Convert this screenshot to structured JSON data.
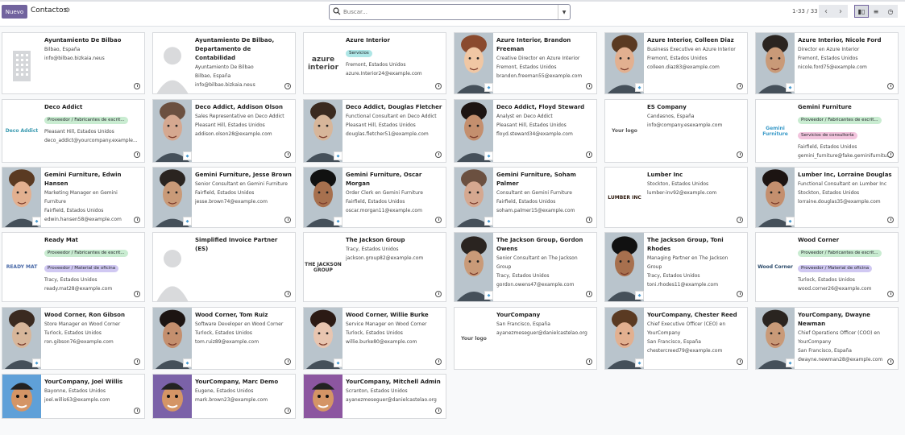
{
  "control_panel": {
    "new_label": "Nuevo",
    "title": "Contactos",
    "search_placeholder": "Buscar...",
    "pager": "1-33 / 33"
  },
  "colors": {
    "primary": "#71639e",
    "tag_green": "#c9ecd1",
    "tag_teal": "#aee6e6",
    "tag_purple": "#d0c8f2",
    "tag_pink": "#f2c4dd"
  },
  "contacts": [
    {
      "name": "Ayuntamiento De Bilbao",
      "lines": [
        "Bilbao, España",
        "info@bilbao.bizkaia.neus"
      ],
      "tags": [],
      "thumb": "building-icon"
    },
    {
      "name": "Ayuntamiento De Bilbao, Departamento de Contabilidad",
      "lines": [
        "Ayuntamiento De Bilbao",
        "Bilbao, España",
        "info@bilbao.bizkaia.neus"
      ],
      "tags": [],
      "thumb": "person-silhouette"
    },
    {
      "name": "Azure Interior",
      "lines": [
        "Fremont, Estados Unidos",
        "azure.Interior24@example.com"
      ],
      "tags": [
        {
          "label": "Servicios",
          "color": "teal"
        }
      ],
      "thumb": "azure-logo",
      "logo_text": "azure interior"
    },
    {
      "name": "Azure Interior, Brandon Freeman",
      "lines": [
        "Creative Director en Azure Interior",
        "Fremont, Estados Unidos",
        "brandon.freeman55@example.com"
      ],
      "tags": [],
      "thumb": "photo"
    },
    {
      "name": "Azure Interior, Colleen Diaz",
      "lines": [
        "Business Executive en Azure Interior",
        "Fremont, Estados Unidos",
        "colleen.diaz83@example.com"
      ],
      "tags": [],
      "thumb": "photo"
    },
    {
      "name": "Azure Interior, Nicole Ford",
      "lines": [
        "Director en Azure Interior",
        "Fremont, Estados Unidos",
        "nicole.ford75@example.com"
      ],
      "tags": [],
      "thumb": "photo"
    },
    {
      "name": "Deco Addict",
      "lines": [
        "Pleasant Hill, Estados Unidos",
        "deco_addict@yourcompany.example..."
      ],
      "tags": [
        {
          "label": "Proveedor / Fabricantes de escrit...",
          "color": "green"
        }
      ],
      "thumb": "deco-logo",
      "logo_text": "Deco Addict"
    },
    {
      "name": "Deco Addict, Addison Olson",
      "lines": [
        "Sales Representative en Deco Addict",
        "Pleasant Hill, Estados Unidos",
        "addison.olson28@example.com"
      ],
      "tags": [],
      "thumb": "photo"
    },
    {
      "name": "Deco Addict, Douglas Fletcher",
      "lines": [
        "Functional Consultant en Deco Addict",
        "Pleasant Hill, Estados Unidos",
        "douglas.fletcher51@example.com"
      ],
      "tags": [],
      "thumb": "photo"
    },
    {
      "name": "Deco Addict, Floyd Steward",
      "lines": [
        "Analyst en Deco Addict",
        "Pleasant Hill, Estados Unidos",
        "floyd.steward34@example.com"
      ],
      "tags": [],
      "thumb": "photo"
    },
    {
      "name": "ES Company",
      "lines": [
        "Candasnos, España",
        "info@company.esexample.com"
      ],
      "tags": [],
      "thumb": "your-logo",
      "logo_text": "Your logo"
    },
    {
      "name": "Gemini Furniture",
      "lines": [
        "Fairfield, Estados Unidos",
        "gemini_furniture@fake.geminifurnitu..."
      ],
      "tags": [
        {
          "label": "Proveedor / Fabricantes de escrit...",
          "color": "green"
        },
        {
          "label": "Servicios de consultoría",
          "color": "pink"
        }
      ],
      "thumb": "gemini-logo",
      "logo_text": "Gemini Furniture"
    },
    {
      "name": "Gemini Furniture, Edwin Hansen",
      "lines": [
        "Marketing Manager en Gemini",
        "Furniture",
        "Fairfield, Estados Unidos",
        "edwin.hansen58@example.com"
      ],
      "tags": [],
      "thumb": "photo"
    },
    {
      "name": "Gemini Furniture, Jesse Brown",
      "lines": [
        "Senior Consultant en Gemini Furniture",
        "Fairfield, Estados Unidos",
        "jesse.brown74@example.com"
      ],
      "tags": [],
      "thumb": "photo"
    },
    {
      "name": "Gemini Furniture, Oscar Morgan",
      "lines": [
        "Order Clerk en Gemini Furniture",
        "Fairfield, Estados Unidos",
        "oscar.morgan11@example.com"
      ],
      "tags": [],
      "thumb": "photo"
    },
    {
      "name": "Gemini Furniture, Soham Palmer",
      "lines": [
        "Consultant en Gemini Furniture",
        "Fairfield, Estados Unidos",
        "soham.palmer15@example.com"
      ],
      "tags": [],
      "thumb": "photo"
    },
    {
      "name": "Lumber Inc",
      "lines": [
        "Stockton, Estados Unidos",
        "lumber-inv92@example.com"
      ],
      "tags": [],
      "thumb": "lumber-logo",
      "logo_text": "LUMBER INC"
    },
    {
      "name": "Lumber Inc, Lorraine Douglas",
      "lines": [
        "Functional Consultant en Lumber Inc",
        "Stockton, Estados Unidos",
        "lorraine.douglas35@example.com"
      ],
      "tags": [],
      "thumb": "photo"
    },
    {
      "name": "Ready Mat",
      "lines": [
        "Tracy, Estados Unidos",
        "ready.mat28@example.com"
      ],
      "tags": [
        {
          "label": "Proveedor / Fabricantes de escrit...",
          "color": "green"
        },
        {
          "label": "Proveedor / Material de oficina",
          "color": "purple"
        }
      ],
      "thumb": "readymat-logo",
      "logo_text": "READY MAT"
    },
    {
      "name": "Simplified Invoice Partner (ES)",
      "lines": [],
      "tags": [],
      "thumb": "person-silhouette"
    },
    {
      "name": "The Jackson Group",
      "lines": [
        "Tracy, Estados Unidos",
        "jackson.group82@example.com"
      ],
      "tags": [],
      "thumb": "jackson-logo",
      "logo_text": "THE JACKSON GROUP"
    },
    {
      "name": "The Jackson Group, Gordon Owens",
      "lines": [
        "Senior Consultant en The Jackson",
        "Group",
        "Tracy, Estados Unidos",
        "gordon.owens47@example.com"
      ],
      "tags": [],
      "thumb": "photo"
    },
    {
      "name": "The Jackson Group, Toni Rhodes",
      "lines": [
        "Managing Partner en The Jackson",
        "Group",
        "Tracy, Estados Unidos",
        "toni.rhodes11@example.com"
      ],
      "tags": [],
      "thumb": "photo"
    },
    {
      "name": "Wood Corner",
      "lines": [
        "Turlock, Estados Unidos",
        "wood.corner26@example.com"
      ],
      "tags": [
        {
          "label": "Proveedor / Fabricantes de escrit...",
          "color": "green"
        },
        {
          "label": "Proveedor / Material de oficina",
          "color": "purple"
        }
      ],
      "thumb": "woodcorner-logo",
      "logo_text": "Wood Corner"
    },
    {
      "name": "Wood Corner, Ron Gibson",
      "lines": [
        "Store Manager en Wood Corner",
        "Turlock, Estados Unidos",
        "ron.gibson76@example.com"
      ],
      "tags": [],
      "thumb": "photo"
    },
    {
      "name": "Wood Corner, Tom Ruiz",
      "lines": [
        "Software Developer en Wood Corner",
        "Turlock, Estados Unidos",
        "tom.ruiz89@example.com"
      ],
      "tags": [],
      "thumb": "photo"
    },
    {
      "name": "Wood Corner, Willie Burke",
      "lines": [
        "Service Manager en Wood Corner",
        "Turlock, Estados Unidos",
        "willie.burke80@example.com"
      ],
      "tags": [],
      "thumb": "photo"
    },
    {
      "name": "YourCompany",
      "lines": [
        "San Francisco, España",
        "ayanezmeseguer@danielcastelao.org"
      ],
      "tags": [],
      "thumb": "your-logo",
      "logo_text": "Your logo"
    },
    {
      "name": "YourCompany, Chester Reed",
      "lines": [
        "Chief Executive Officer (CEO) en",
        "YourCompany",
        "San Francisco, España",
        "chestercreed79@example.com"
      ],
      "tags": [],
      "thumb": "photo"
    },
    {
      "name": "YourCompany, Dwayne Newman",
      "lines": [
        "Chief Operations Officer (COO) en",
        "YourCompany",
        "San Francisco, España",
        "dwayne.newman28@example.com"
      ],
      "tags": [],
      "thumb": "photo"
    },
    {
      "name": "YourCompany, Joel Willis",
      "lines": [
        "Bayonne, Estados Unidos",
        "joel.willis63@example.com"
      ],
      "tags": [],
      "thumb": "avatar"
    },
    {
      "name": "YourCompany, Marc Demo",
      "lines": [
        "Eugene, Estados Unidos",
        "mark.brown23@example.com"
      ],
      "tags": [],
      "thumb": "avatar"
    },
    {
      "name": "YourCompany, Mitchell Admin",
      "lines": [
        "Scranton, Estados Unidos",
        "ayanezmeseguer@danielcastelao.org"
      ],
      "tags": [],
      "thumb": "avatar"
    }
  ]
}
